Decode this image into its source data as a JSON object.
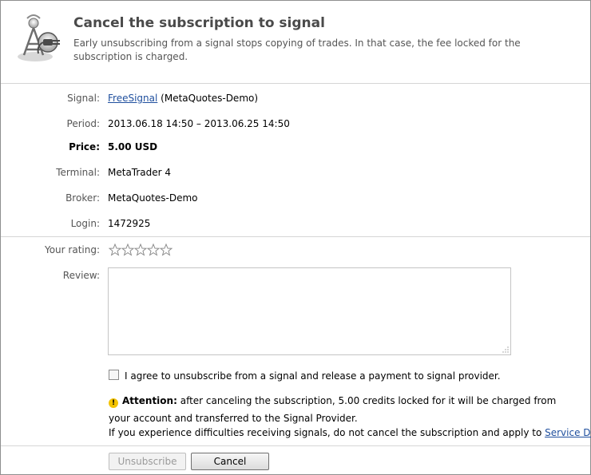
{
  "header": {
    "title": "Cancel the subscription to signal",
    "description": "Early unsubscribing from a signal stops copying of trades. In that case, the fee locked for the subscription is charged."
  },
  "details": {
    "signal_label": "Signal:",
    "signal_name": "FreeSignal",
    "signal_server": "(MetaQuotes-Demo)",
    "period_label": "Period:",
    "period_value": "2013.06.18 14:50 – 2013.06.25 14:50",
    "price_label": "Price:",
    "price_value": "5.00 USD",
    "terminal_label": "Terminal:",
    "terminal_value": "MetaTrader 4",
    "broker_label": "Broker:",
    "broker_value": "MetaQuotes-Demo",
    "login_label": "Login:",
    "login_value": "1472925"
  },
  "rating": {
    "label": "Your rating:",
    "max": 5,
    "value": 0
  },
  "review": {
    "label": "Review:",
    "value": ""
  },
  "agreement": {
    "checked": false,
    "text": "I agree to unsubscribe from a signal and release a payment to signal provider."
  },
  "attention": {
    "title": "Attention:",
    "text": "after canceling the subscription, 5.00 credits locked for it will be charged from your account and transferred to the Signal Provider."
  },
  "help": {
    "text": "If you experience difficulties receiving signals, do not cancel the subscription and apply to",
    "link": "Service Desk",
    "end": "."
  },
  "buttons": {
    "unsubscribe": "Unsubscribe",
    "cancel": "Cancel"
  },
  "icons": {
    "header": "signal-unplug-icon",
    "star": "star-outline-icon",
    "warning": "warning-icon"
  }
}
